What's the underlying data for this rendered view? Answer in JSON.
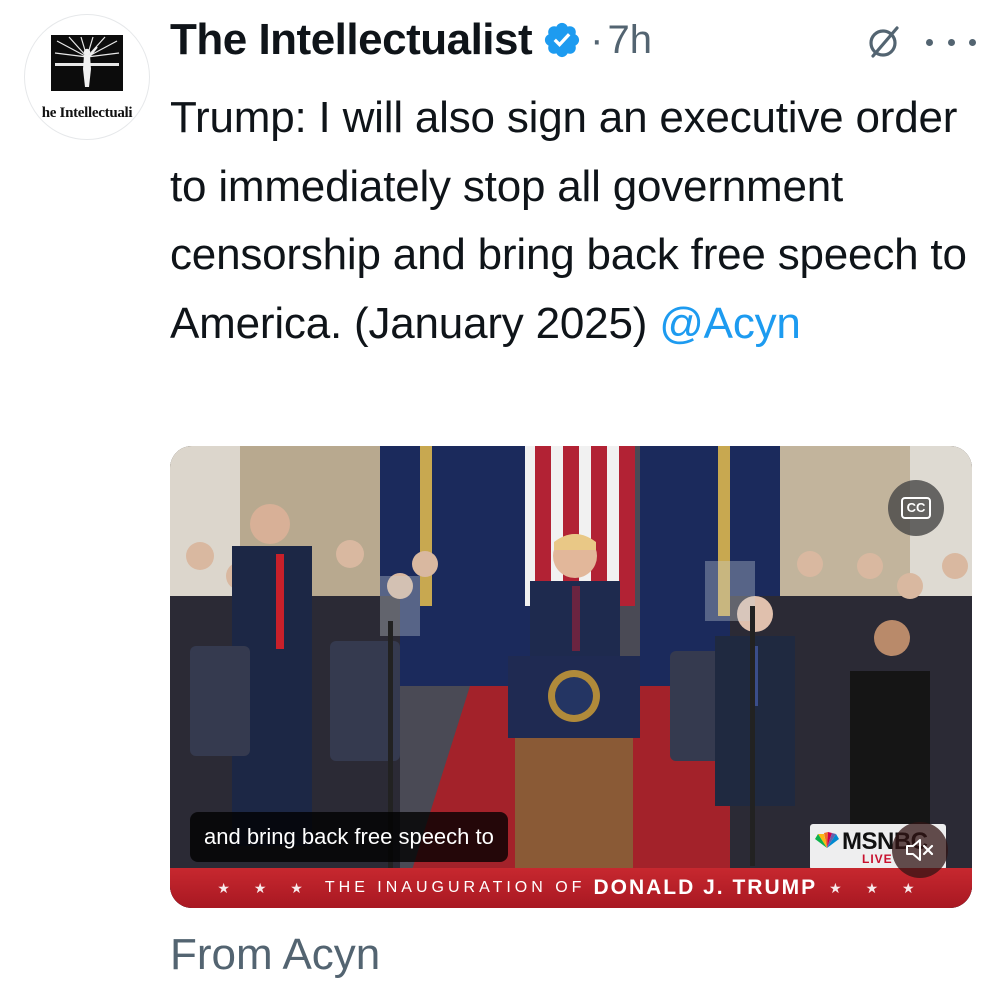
{
  "author": {
    "display_name": "The Intellectualist",
    "avatar_text": "he Intellectuali",
    "verified_icon": "verified-badge-icon",
    "separator": "·",
    "time": "7h"
  },
  "actions": {
    "grok_icon": "grok-icon",
    "more_icon": "more-icon"
  },
  "tweet": {
    "text": "Trump: I will also sign an executive order to immediately stop all government censorship and bring back free speech to America. (January 2025) ",
    "mention": "@Acyn"
  },
  "media": {
    "cc_label": "CC",
    "caption": "and bring back free speech to",
    "network": "MSNBC",
    "live_label": "LIVE",
    "banner_prefix": "THE INAUGURATION OF",
    "banner_name": "DONALD J. TRUMP",
    "mute_icon": "muted-speaker-icon"
  },
  "source": {
    "from_text": "From Acyn"
  },
  "colors": {
    "link": "#1d9bf0",
    "verified": "#1d9bf0",
    "muted_text": "#536471",
    "banner": "#b81f28"
  }
}
